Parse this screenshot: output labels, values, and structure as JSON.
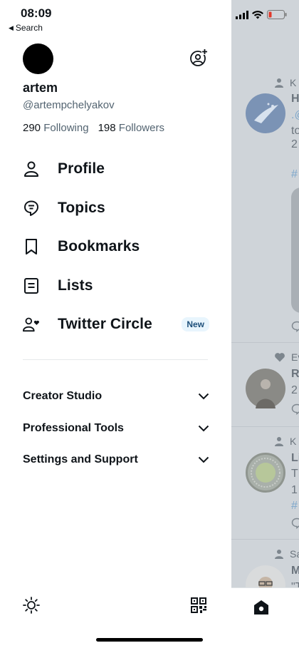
{
  "status_bar": {
    "time": "08:09",
    "back_label": "Search"
  },
  "profile": {
    "display_name": "artem",
    "handle": "@artempchelyakov",
    "following_count": "290",
    "following_label": "Following",
    "followers_count": "198",
    "followers_label": "Followers"
  },
  "menu": {
    "items": [
      {
        "label": "Profile",
        "icon": "person-icon"
      },
      {
        "label": "Topics",
        "icon": "topics-icon"
      },
      {
        "label": "Bookmarks",
        "icon": "bookmark-icon"
      },
      {
        "label": "Lists",
        "icon": "list-icon"
      },
      {
        "label": "Twitter Circle",
        "icon": "circle-people-icon",
        "badge": "New"
      }
    ]
  },
  "sections": [
    {
      "label": "Creator Studio"
    },
    {
      "label": "Professional Tools"
    },
    {
      "label": "Settings and Support"
    }
  ],
  "timeline_fragments": {
    "item1_ctx": "K",
    "item1_line1": "H",
    "item1_line2": ".@",
    "item1_line3": "to",
    "item1_line4": "2",
    "item1_hashtag": "#",
    "item2_ctx": "Ev",
    "item2_line1": "R",
    "item2_line2": "2",
    "item3_ctx": "K",
    "item3_line1": "Li",
    "item3_line2": "T",
    "item3_line3": "1",
    "item3_hashtag": "#",
    "item4_ctx": "Sa",
    "item4_line1": "M",
    "item4_line2": "\"T"
  },
  "colors": {
    "accent": "#1d9bf0",
    "text": "#0f1419",
    "secondary": "#536471",
    "overlay": "#cfd4d9"
  }
}
